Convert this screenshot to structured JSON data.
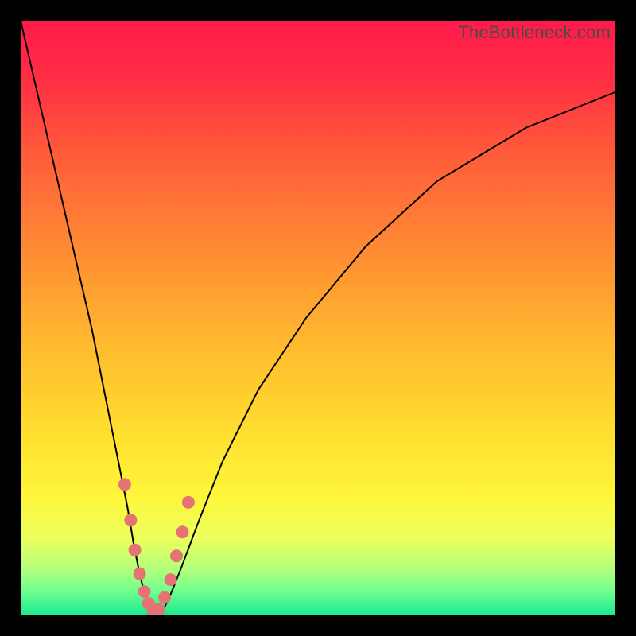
{
  "watermark": "TheBottleneck.com",
  "chart_data": {
    "type": "line",
    "title": "",
    "xlabel": "",
    "ylabel": "",
    "xlim": [
      0,
      100
    ],
    "ylim": [
      0,
      100
    ],
    "grid": false,
    "legend": false,
    "background_gradient": {
      "top": "#ff1a4b",
      "mid": "#ffe02f",
      "bottom": "#18e994"
    },
    "series": [
      {
        "name": "bottleneck-curve",
        "x": [
          0,
          3,
          6,
          9,
          12,
          14,
          16,
          18,
          19,
          20,
          21,
          22,
          23,
          24,
          25,
          27,
          30,
          34,
          40,
          48,
          58,
          70,
          85,
          100
        ],
        "values": [
          100,
          87,
          74,
          61,
          48,
          38,
          28,
          18,
          12,
          7,
          3,
          1,
          0,
          1,
          3,
          8,
          16,
          26,
          38,
          50,
          62,
          73,
          82,
          88
        ]
      }
    ],
    "markers": {
      "name": "highlighted-points",
      "x": [
        17.5,
        18.5,
        19.2,
        20.0,
        20.8,
        21.5,
        22.3,
        23.2,
        24.2,
        25.2,
        26.2,
        27.2,
        28.2
      ],
      "values": [
        22,
        16,
        11,
        7,
        4,
        2,
        0.5,
        1,
        3,
        6,
        10,
        14,
        19
      ]
    }
  }
}
